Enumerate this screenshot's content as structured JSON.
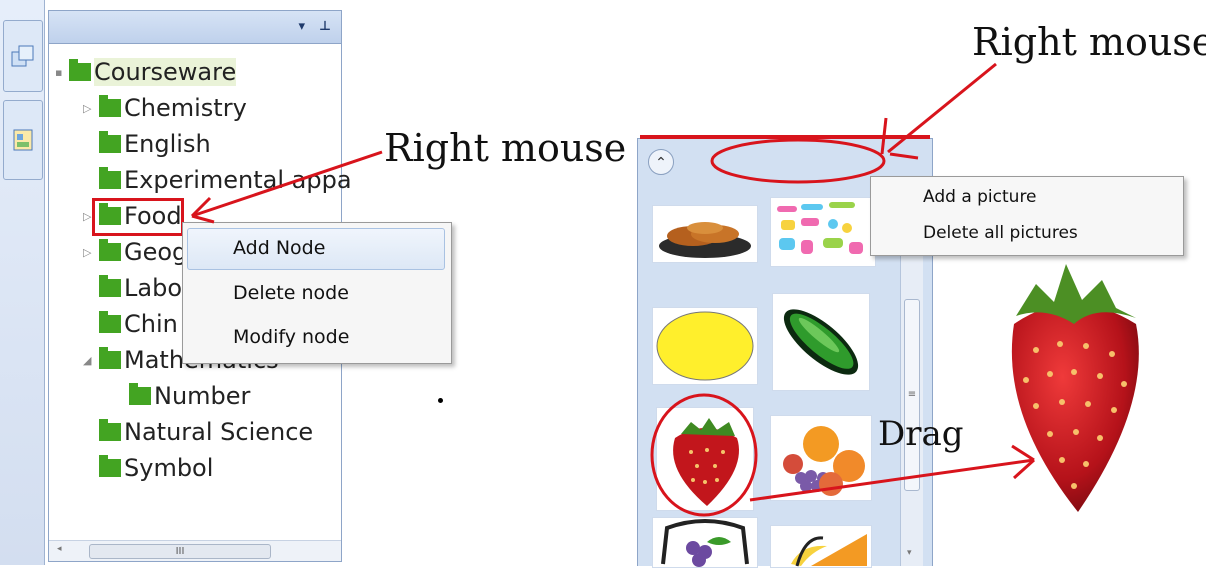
{
  "tree_panel": {
    "header": {
      "dropdown_icon": "▾",
      "pin_icon": "⊥"
    },
    "root": "Courseware",
    "nodes": [
      {
        "label": "Chemistry",
        "expander": "▷"
      },
      {
        "label": "English",
        "expander": ""
      },
      {
        "label": "Experimental appa",
        "expander": ""
      },
      {
        "label": "Food",
        "expander": "▷"
      },
      {
        "label": "Geog",
        "expander": "▷"
      },
      {
        "label": "Labo",
        "expander": ""
      },
      {
        "label": "Chin",
        "expander": ""
      },
      {
        "label": "Mathematics",
        "expander": "◢"
      },
      {
        "label": "Number",
        "expander": ""
      },
      {
        "label": "Natural Science",
        "expander": ""
      },
      {
        "label": "Symbol",
        "expander": ""
      }
    ],
    "scrollbar_grip": "III"
  },
  "node_context_menu": {
    "items": [
      "Add Node",
      "Delete node",
      "Modify node"
    ]
  },
  "picture_panel": {
    "collapse_icon": "⌃",
    "context_menu": {
      "items": [
        "Add a picture",
        "Delete all pictures"
      ]
    },
    "thumbnails": [
      "food-plate",
      "candy-shapes",
      "lemon",
      "cucumber",
      "strawberry",
      "fruit-bowl",
      "fruit-basket",
      "bananas"
    ],
    "scroll_grip": "≡"
  },
  "annotations": {
    "right_mouse_left": "Right mouse",
    "right_mouse_top": "Right mouse",
    "drag": "Drag"
  },
  "colors": {
    "annotation_red": "#d8141c",
    "folder_green": "#43a422",
    "panel_blue": "#d2e0f2"
  }
}
